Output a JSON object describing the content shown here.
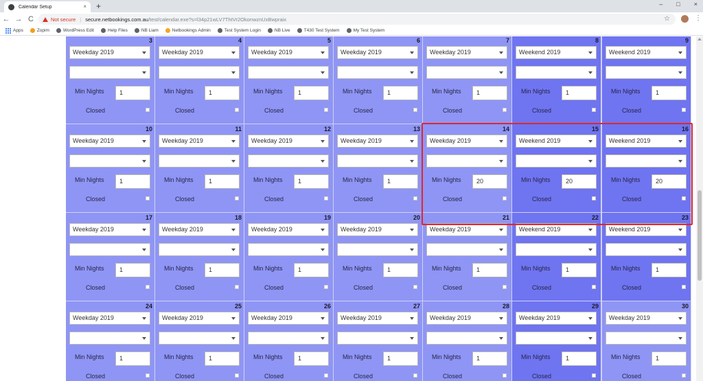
{
  "browser": {
    "tab_title": "Calendar Setup",
    "tab_close": "×",
    "new_tab": "+",
    "window_controls": [
      "–",
      "□",
      "×"
    ],
    "back": "←",
    "forward": "→",
    "reload": "C",
    "security_label": "Not secure",
    "separator": "|",
    "url_host": "secure.netbookings.com.au",
    "url_path": "/test/calendar.exe?s=l34p21wLV7ThtVr2OkonwznUxBwpraix",
    "star": "☆",
    "menu": "⋮",
    "bookmarks": [
      {
        "label": "Apps",
        "icon": "apps-grid-icon"
      },
      {
        "label": "Zopim",
        "icon": "zopim-icon"
      },
      {
        "label": "WordPress Edit",
        "icon": "globe-icon"
      },
      {
        "label": "Help Files",
        "icon": "globe-icon"
      },
      {
        "label": "NB Liam",
        "icon": "globe-icon"
      },
      {
        "label": "Netbookings Admin",
        "icon": "netbookings-icon"
      },
      {
        "label": "Test System Login",
        "icon": "nb-icon"
      },
      {
        "label": "NB Live",
        "icon": "nb-icon"
      },
      {
        "label": "T430 Test System",
        "icon": "globe-icon"
      },
      {
        "label": "My Test System",
        "icon": "globe-icon"
      }
    ]
  },
  "calendar": {
    "labels": {
      "min_nights": "Min Nights",
      "closed": "Closed"
    },
    "colors": {
      "weekday": "#8f95f4",
      "weekend": "#6f74f0",
      "highlight": "#e0262e"
    },
    "weeks": [
      [
        {
          "day": "3",
          "rate": "Weekday 2019",
          "min": "1",
          "type": "weekday"
        },
        {
          "day": "4",
          "rate": "Weekday 2019",
          "min": "1",
          "type": "weekday"
        },
        {
          "day": "5",
          "rate": "Weekday 2019",
          "min": "1",
          "type": "weekday"
        },
        {
          "day": "6",
          "rate": "Weekday 2019",
          "min": "1",
          "type": "weekday"
        },
        {
          "day": "7",
          "rate": "Weekday 2019",
          "min": "1",
          "type": "weekday"
        },
        {
          "day": "8",
          "rate": "Weekend 2019",
          "min": "1",
          "type": "weekend"
        },
        {
          "day": "9",
          "rate": "Weekend 2019",
          "min": "1",
          "type": "weekend"
        }
      ],
      [
        {
          "day": "10",
          "rate": "Weekday 2019",
          "min": "1",
          "type": "weekday"
        },
        {
          "day": "11",
          "rate": "Weekday 2019",
          "min": "1",
          "type": "weekday"
        },
        {
          "day": "12",
          "rate": "Weekday 2019",
          "min": "1",
          "type": "weekday"
        },
        {
          "day": "13",
          "rate": "Weekday 2019",
          "min": "1",
          "type": "weekday"
        },
        {
          "day": "14",
          "rate": "Weekday 2019",
          "min": "20",
          "type": "weekday"
        },
        {
          "day": "15",
          "rate": "Weekend 2019",
          "min": "20",
          "type": "weekend"
        },
        {
          "day": "16",
          "rate": "Weekend 2019",
          "min": "20",
          "type": "weekend"
        }
      ],
      [
        {
          "day": "17",
          "rate": "Weekday 2019",
          "min": "1",
          "type": "weekday"
        },
        {
          "day": "18",
          "rate": "Weekday 2019",
          "min": "1",
          "type": "weekday"
        },
        {
          "day": "19",
          "rate": "Weekday 2019",
          "min": "1",
          "type": "weekday"
        },
        {
          "day": "20",
          "rate": "Weekday 2019",
          "min": "1",
          "type": "weekday"
        },
        {
          "day": "21",
          "rate": "Weekday 2019",
          "min": "1",
          "type": "weekday"
        },
        {
          "day": "22",
          "rate": "Weekend 2019",
          "min": "1",
          "type": "weekend"
        },
        {
          "day": "23",
          "rate": "Weekend 2019",
          "min": "1",
          "type": "weekend"
        }
      ],
      [
        {
          "day": "24",
          "rate": "Weekday 2019",
          "min": "1",
          "type": "weekday"
        },
        {
          "day": "25",
          "rate": "Weekday 2019",
          "min": "1",
          "type": "weekday"
        },
        {
          "day": "26",
          "rate": "Weekday 2019",
          "min": "1",
          "type": "weekday"
        },
        {
          "day": "27",
          "rate": "Weekday 2019",
          "min": "1",
          "type": "weekday"
        },
        {
          "day": "28",
          "rate": "Weekday 2019",
          "min": "1",
          "type": "weekday"
        },
        {
          "day": "29",
          "rate": "Weekday 2019",
          "min": "1",
          "type": "weekend"
        },
        {
          "day": "30",
          "rate": "Weekday 2019",
          "min": "1",
          "type": "weekday"
        }
      ]
    ]
  }
}
